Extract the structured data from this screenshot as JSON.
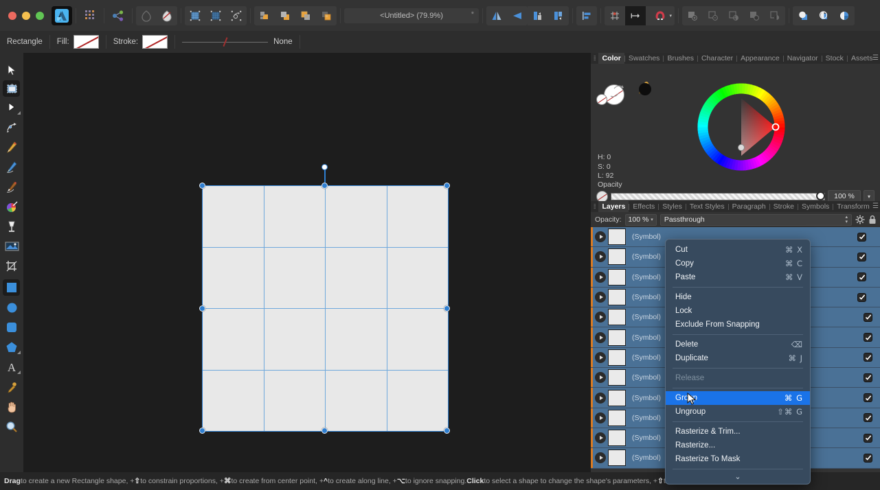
{
  "app": {
    "name": "Affinity Designer",
    "icon": "affinity-designer-icon"
  },
  "window": {
    "close_label": "",
    "minimize_label": "",
    "maximize_label": "",
    "document_title": "<Untitled> (79.9%)",
    "modified_marker": "*"
  },
  "toolbar": {
    "buttons": [
      {
        "name": "assistant-icon",
        "label": ""
      },
      {
        "name": "share-icon",
        "label": ""
      },
      {
        "name": "pixel-persona-icon",
        "label": ""
      },
      {
        "name": "export-persona-icon",
        "label": ""
      },
      {
        "name": "show-grid-icon",
        "label": ""
      },
      {
        "name": "snap-to-grid-icon",
        "label": ""
      },
      {
        "name": "transform-objects-icon",
        "label": ""
      },
      {
        "name": "move-forward-icon",
        "label": ""
      },
      {
        "name": "move-to-front-icon",
        "label": ""
      },
      {
        "name": "move-back-icon",
        "label": ""
      },
      {
        "name": "move-to-back-icon",
        "label": ""
      },
      {
        "name": "flip-horizontal-icon",
        "label": ""
      },
      {
        "name": "flip-vertical-icon",
        "label": ""
      },
      {
        "name": "rotate-left-icon",
        "label": ""
      },
      {
        "name": "rotate-right-icon",
        "label": ""
      },
      {
        "name": "alignment-icon",
        "label": ""
      },
      {
        "name": "grid-settings-icon",
        "label": ""
      },
      {
        "name": "snapping-candidates-icon",
        "label": ""
      },
      {
        "name": "snapping-magnet-icon",
        "label": ""
      },
      {
        "name": "boolean-add-icon",
        "label": ""
      },
      {
        "name": "boolean-subtract-icon",
        "label": ""
      },
      {
        "name": "boolean-intersect-icon",
        "label": ""
      },
      {
        "name": "boolean-xor-icon",
        "label": ""
      },
      {
        "name": "boolean-divide-icon",
        "label": ""
      },
      {
        "name": "mask-layer-icon",
        "label": ""
      },
      {
        "name": "adjustment-icon",
        "label": ""
      },
      {
        "name": "live-filter-icon",
        "label": ""
      }
    ]
  },
  "context_bar": {
    "tool_name": "Rectangle",
    "fill_label": "Fill:",
    "fill_value": "none",
    "stroke_label": "Stroke:",
    "stroke_value": "none",
    "stroke_width_label": "None"
  },
  "tools": {
    "items": [
      {
        "name": "move-tool",
        "label": "Move Tool"
      },
      {
        "name": "artboard-tool",
        "label": "Artboard Tool",
        "active": true
      },
      {
        "name": "node-tool",
        "label": "Node Tool"
      },
      {
        "name": "corner-tool",
        "label": "Corner Tool"
      },
      {
        "name": "pen-tool",
        "label": "Pen Tool"
      },
      {
        "name": "pencil-tool",
        "label": "Pencil Tool"
      },
      {
        "name": "vector-brush-tool",
        "label": "Vector Brush Tool"
      },
      {
        "name": "fill-tool",
        "label": "Fill Tool"
      },
      {
        "name": "transparency-tool",
        "label": "Transparency Tool"
      },
      {
        "name": "place-image-tool",
        "label": "Place Image Tool"
      },
      {
        "name": "vector-crop-tool",
        "label": "Vector Crop Tool"
      },
      {
        "name": "rectangle-tool",
        "label": "Rectangle Tool",
        "active": true
      },
      {
        "name": "ellipse-tool",
        "label": "Ellipse Tool"
      },
      {
        "name": "rounded-rectangle-tool",
        "label": "Rounded Rectangle Tool"
      },
      {
        "name": "polygon-tool",
        "label": "Polygon Tool"
      },
      {
        "name": "text-tool",
        "label": "Artistic Text Tool"
      },
      {
        "name": "color-picker-tool",
        "label": "Color Picker Tool"
      },
      {
        "name": "pan-tool",
        "label": "View Tool"
      },
      {
        "name": "zoom-tool",
        "label": "Zoom Tool"
      }
    ]
  },
  "canvas": {
    "shape_name": "symbol-grid",
    "rows": 4,
    "columns": 4,
    "cell_color": "#e8e8e8",
    "selection_color": "#2f7fd1",
    "zoom": "79.9%"
  },
  "color_panel": {
    "tabs": [
      {
        "label": "Color",
        "active": true
      },
      {
        "label": "Swatches",
        "active": false
      },
      {
        "label": "Brushes",
        "active": false
      },
      {
        "label": "Character",
        "active": false
      },
      {
        "label": "Appearance",
        "active": false
      },
      {
        "label": "Navigator",
        "active": false
      },
      {
        "label": "Stock",
        "active": false
      },
      {
        "label": "Assets",
        "active": false
      }
    ],
    "hue_label": "H: 0",
    "sat_label": "S: 0",
    "lum_label": "L: 92",
    "opacity_label": "Opacity",
    "opacity_value": "100 %",
    "dropdown_glyph": "▾",
    "eyedropper_icon": "eyedropper-icon"
  },
  "layers_panel": {
    "tabs": [
      {
        "label": "Layers",
        "active": true
      },
      {
        "label": "Effects",
        "active": false
      },
      {
        "label": "Styles",
        "active": false
      },
      {
        "label": "Text Styles",
        "active": false
      },
      {
        "label": "Paragraph",
        "active": false
      },
      {
        "label": "Stroke",
        "active": false
      },
      {
        "label": "Symbols",
        "active": false
      },
      {
        "label": "Transform",
        "active": false
      }
    ],
    "opacity_label": "Opacity:",
    "opacity_value": "100 %",
    "blend_mode": "Passthrough",
    "gear_icon": "gear-icon",
    "lock_icon": "lock-icon",
    "rows": [
      {
        "label": "(Symbol)",
        "checked": true,
        "indent": 0
      },
      {
        "label": "(Symbol)",
        "checked": true,
        "indent": 0
      },
      {
        "label": "(Symbol)",
        "checked": true,
        "indent": 0
      },
      {
        "label": "(Symbol)",
        "checked": true,
        "indent": 0
      },
      {
        "label": "(Symbol)",
        "checked": true,
        "indent": 1
      },
      {
        "label": "(Symbol)",
        "checked": true,
        "indent": 1
      },
      {
        "label": "(Symbol)",
        "checked": true,
        "indent": 1
      },
      {
        "label": "(Symbol)",
        "checked": true,
        "indent": 1
      },
      {
        "label": "(Symbol)",
        "checked": true,
        "indent": 1
      },
      {
        "label": "(Symbol)",
        "checked": true,
        "indent": 1
      },
      {
        "label": "(Symbol)",
        "checked": true,
        "indent": 1
      },
      {
        "label": "(Symbol)",
        "checked": true,
        "indent": 1
      }
    ],
    "footer": {
      "stack_icon": "layer-stack-icon",
      "new_layer_icon": "new-layer-icon",
      "mask_icon": "mask-layer-icon",
      "delete_icon": "trash-icon"
    }
  },
  "context_menu": {
    "items": [
      {
        "label": "Cut",
        "shortcut": "⌘ X",
        "state": "normal"
      },
      {
        "label": "Copy",
        "shortcut": "⌘ C",
        "state": "normal"
      },
      {
        "label": "Paste",
        "shortcut": "⌘ V",
        "state": "normal"
      },
      {
        "separator": true
      },
      {
        "label": "Hide",
        "shortcut": "",
        "state": "normal"
      },
      {
        "label": "Lock",
        "shortcut": "",
        "state": "normal"
      },
      {
        "label": "Exclude From Snapping",
        "shortcut": "",
        "state": "normal"
      },
      {
        "separator": true
      },
      {
        "label": "Delete",
        "shortcut": "⌫",
        "state": "normal"
      },
      {
        "label": "Duplicate",
        "shortcut": "⌘ J",
        "state": "normal"
      },
      {
        "separator": true
      },
      {
        "label": "Release",
        "shortcut": "",
        "state": "disabled"
      },
      {
        "separator": true
      },
      {
        "label": "Group",
        "shortcut": "⌘ G",
        "state": "highlighted"
      },
      {
        "label": "Ungroup",
        "shortcut": "⇧⌘ G",
        "state": "normal"
      },
      {
        "separator": true
      },
      {
        "label": "Rasterize & Trim...",
        "shortcut": "",
        "state": "normal"
      },
      {
        "label": "Rasterize...",
        "shortcut": "",
        "state": "normal"
      },
      {
        "label": "Rasterize To Mask",
        "shortcut": "",
        "state": "normal"
      },
      {
        "separator": true
      }
    ],
    "scroll_more_glyph": "⌄",
    "highlight_color": "#1a73e8"
  },
  "status_bar": {
    "segments": [
      {
        "text": "Drag",
        "bold": true
      },
      {
        "text": " to create a new Rectangle shape, +",
        "bold": false
      },
      {
        "text": "⇧",
        "bold": true
      },
      {
        "text": " to constrain proportions, +",
        "bold": false
      },
      {
        "text": "⌘",
        "bold": true
      },
      {
        "text": " to create from center point, +",
        "bold": false
      },
      {
        "text": "^",
        "bold": true
      },
      {
        "text": " to create along line, +",
        "bold": false
      },
      {
        "text": "⌥",
        "bold": true
      },
      {
        "text": " to ignore snapping. ",
        "bold": false
      },
      {
        "text": "Click",
        "bold": true
      },
      {
        "text": " to select a shape to change the shape's parameters, +",
        "bold": false
      },
      {
        "text": "⇧",
        "bold": true
      },
      {
        "text": " to toggle",
        "bold": false
      }
    ]
  }
}
